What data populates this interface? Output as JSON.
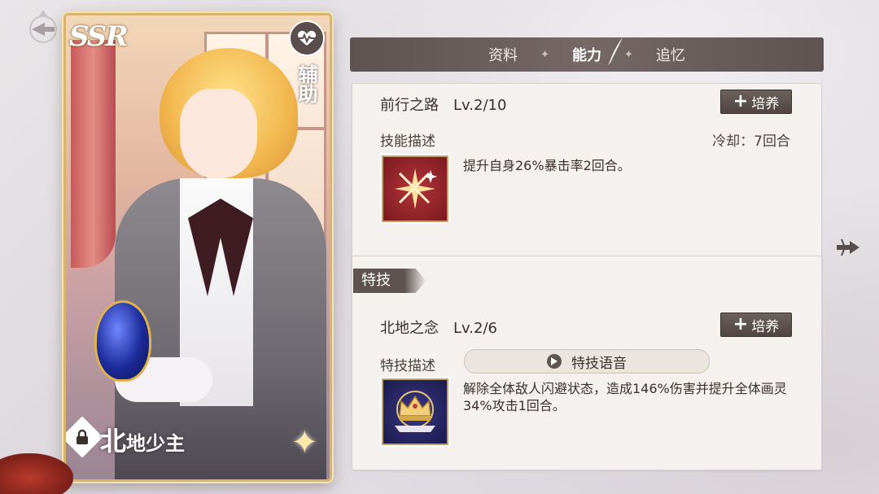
{
  "card": {
    "rarity": "SSR",
    "role": "辅助",
    "name_first": "北",
    "name_rest": "地少主",
    "locked": true
  },
  "tabs": [
    {
      "label": "资料",
      "active": false
    },
    {
      "label": "能力",
      "active": true
    },
    {
      "label": "追忆",
      "active": false
    }
  ],
  "skill": {
    "name": "前行之路",
    "level": "Lv.2/10",
    "train_label": "培养",
    "desc_label": "技能描述",
    "cooldown": "冷却：7回合",
    "description": "提升自身26%暴击率2回合。"
  },
  "special": {
    "section_label": "特技",
    "name": "北地之念",
    "level": "Lv.2/6",
    "train_label": "培养",
    "desc_label": "特技描述",
    "voice_label": "特技语音",
    "description": "解除全体敌人闪避状态，造成146%伤害并提升全体画灵34%攻击1回合。"
  },
  "colors": {
    "tab_bar": "#6a5e5b",
    "panel_bg": "#f4f1ee",
    "gold_frame": "#d8b56a",
    "skill_icon_bg": "#8c1f24",
    "special_icon_bg": "#1f1e55"
  }
}
